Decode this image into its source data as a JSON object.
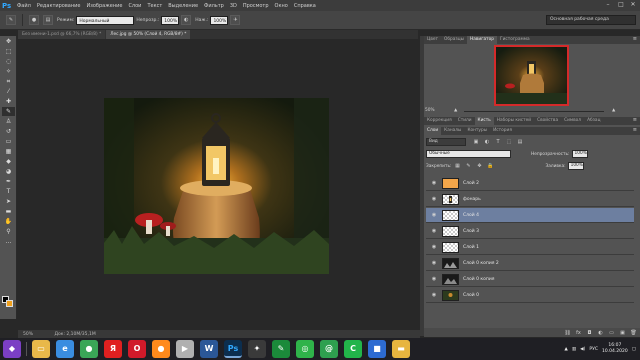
{
  "app": {
    "logo": "Ps"
  },
  "menu": [
    "Файл",
    "Редактирование",
    "Изображение",
    "Слои",
    "Текст",
    "Выделение",
    "Фильтр",
    "3D",
    "Просмотр",
    "Окно",
    "Справка"
  ],
  "window_controls": [
    "–",
    "□",
    "✕"
  ],
  "options_bar": {
    "mode_label": "Режим:",
    "mode_value": "Нормальный",
    "opacity_label": "Непрозр.:",
    "opacity_value": "100%",
    "pressure_label": "Наж.:",
    "pressure_value": "100%",
    "workspace": "Основная рабочая среда"
  },
  "doc_tabs": [
    {
      "label": "Без имени-1.psd @ 66,7% (RGB/8) *",
      "active": false
    },
    {
      "label": "Лес.jpg @ 50% (Слой 4, RGB/8#) *",
      "active": true
    }
  ],
  "status": {
    "zoom": "50%",
    "doc_size": "Док: 2,10М/35,1М"
  },
  "nav_panel": {
    "tabs": [
      "Цвет",
      "Образцы",
      "Навигатор",
      "Гистограмма"
    ],
    "active_tab": "Навигатор",
    "zoom": "50%"
  },
  "mid_panel": {
    "tabs": [
      "Коррекция",
      "Стили",
      "Кисть",
      "Наборы кистей",
      "Свойства",
      "Символ",
      "Абзац"
    ],
    "active_tab": "Кисть"
  },
  "layers_panel": {
    "tabs": [
      "Слои",
      "Каналы",
      "Контуры",
      "История"
    ],
    "active_tab": "Слои",
    "filter_kind": "Вид",
    "blend_mode": "Обычные",
    "opacity_label": "Непрозрачность:",
    "opacity_value": "100%",
    "lock_label": "Закрепить:",
    "fill_label": "Заливка:",
    "fill_value": "100%",
    "layers": [
      {
        "name": "Слой 2",
        "thumb": "orange",
        "selected": false
      },
      {
        "name": "фонарь",
        "thumb": "lantern",
        "selected": false
      },
      {
        "name": "Слой 4",
        "thumb": "checker",
        "selected": true
      },
      {
        "name": "Слой 3",
        "thumb": "checker",
        "selected": false
      },
      {
        "name": "Слой 1",
        "thumb": "checker",
        "selected": false
      },
      {
        "name": "Слой 0 копия 2",
        "thumb": "dark",
        "selected": false
      },
      {
        "name": "Слой 0 копия",
        "thumb": "dark",
        "selected": false
      },
      {
        "name": "Слой 0",
        "thumb": "forest",
        "selected": false
      }
    ]
  },
  "taskbar": {
    "apps": [
      {
        "icon": "start-icon",
        "glyph": "◆",
        "color": "#7b3fc4"
      },
      {
        "icon": "explorer-icon",
        "glyph": "▭",
        "color": "#e8b84a"
      },
      {
        "icon": "ie-icon",
        "glyph": "e",
        "color": "#3a8de0"
      },
      {
        "icon": "chrome-icon",
        "glyph": "●",
        "color": "#3aa657"
      },
      {
        "icon": "yandex-icon",
        "glyph": "Я",
        "color": "#e02020"
      },
      {
        "icon": "opera-icon",
        "glyph": "O",
        "color": "#d01a2a"
      },
      {
        "icon": "firefox-icon",
        "glyph": "●",
        "color": "#ff8a1c"
      },
      {
        "icon": "media-icon",
        "glyph": "▶",
        "color": "#b0b0b0"
      },
      {
        "icon": "word-icon",
        "glyph": "W",
        "color": "#2b5797"
      },
      {
        "icon": "photoshop-icon",
        "glyph": "Ps",
        "color": "#0c2e4f"
      },
      {
        "icon": "app-icon",
        "glyph": "✦",
        "color": "#3a3a3a"
      },
      {
        "icon": "green-app-icon",
        "glyph": "✎",
        "color": "#1b8a3a"
      },
      {
        "icon": "whatsapp-icon",
        "glyph": "◎",
        "color": "#2fb34a"
      },
      {
        "icon": "email-icon",
        "glyph": "@",
        "color": "#2ea04f"
      },
      {
        "icon": "camtasia-icon",
        "glyph": "C",
        "color": "#22b44a"
      },
      {
        "icon": "camera-icon",
        "glyph": "■",
        "color": "#2d6bd1"
      },
      {
        "icon": "folder-icon",
        "glyph": "▬",
        "color": "#e7b53f"
      }
    ],
    "lang": "РУС",
    "time": "16:07",
    "date": "10.04.2020"
  }
}
